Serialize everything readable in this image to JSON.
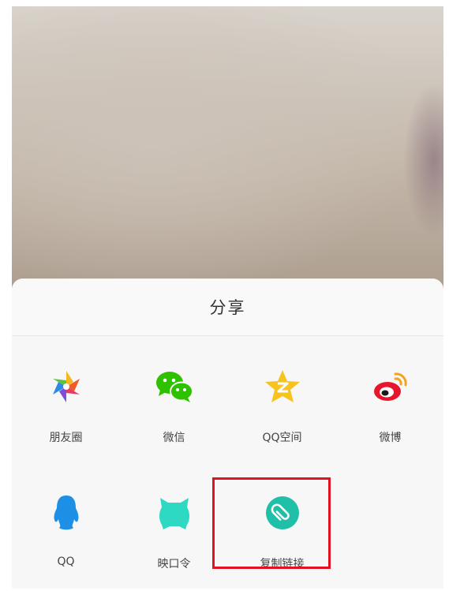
{
  "share_sheet": {
    "title": "分享",
    "items": [
      {
        "label": "朋友圈",
        "icon": "moments-icon"
      },
      {
        "label": "微信",
        "icon": "wechat-icon"
      },
      {
        "label": "QQ空间",
        "icon": "qzone-icon"
      },
      {
        "label": "微博",
        "icon": "weibo-icon"
      },
      {
        "label": "QQ",
        "icon": "qq-icon"
      },
      {
        "label": "映口令",
        "icon": "yingkou-icon"
      },
      {
        "label": "复制链接",
        "icon": "copy-link-icon"
      }
    ]
  },
  "colors": {
    "highlight": "#e0141e",
    "wechat": "#2dc100",
    "qzone": "#f7c31f",
    "weibo": "#e6162d",
    "qq": "#1d8fe5",
    "yingkou": "#2ed9c4",
    "copy_link": "#1fbfa8"
  }
}
